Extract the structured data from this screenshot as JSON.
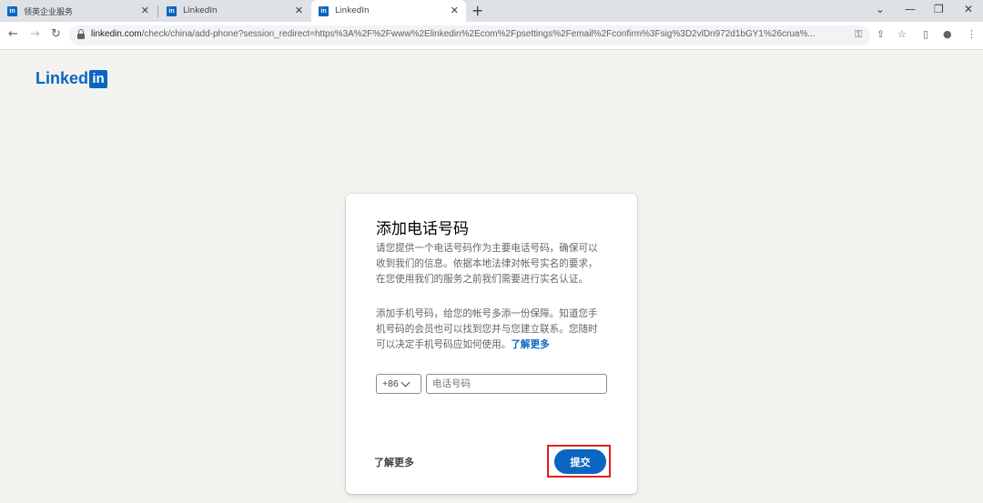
{
  "browser": {
    "tabs": [
      {
        "title": "领英企业服务",
        "favicon": "in"
      },
      {
        "title": "LinkedIn",
        "favicon": "in"
      },
      {
        "title": "LinkedIn",
        "favicon": "in"
      }
    ],
    "new_tab_symbol": "+",
    "url_host": "linkedin.com",
    "url_rest": "/check/china/add-phone?session_redirect=https%3A%2F%2Fwww%2Elinkedin%2Ecom%2Fpsettings%2Femail%2Fconfirm%3Fsig%3D2vlDn972d1bGY1%26crua%..."
  },
  "logo": {
    "text": "Linked",
    "badge": "in"
  },
  "card": {
    "title": "添加电话号码",
    "para1": "请您提供一个电话号码作为主要电话号码，确保可以收到我们的信息。依据本地法律对帐号实名的要求，在您使用我们的服务之前我们需要进行实名认证。",
    "para2": "添加手机号码，给您的帐号多添一份保障。知道您手机号码的会员也可以找到您并与您建立联系。您随时可以决定手机号码应如何使用。",
    "para2_link": "了解更多",
    "country_code": "+86",
    "phone_placeholder": "电话号码",
    "learn_more": "了解更多",
    "submit": "提交"
  },
  "colors": {
    "brand": "#0a66c2",
    "highlight": "#e02020"
  }
}
